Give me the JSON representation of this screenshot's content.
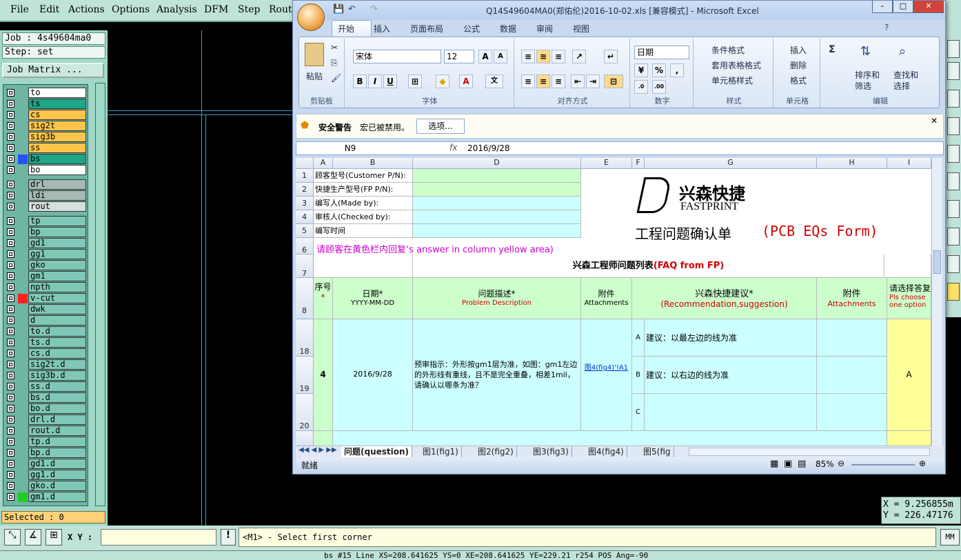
{
  "cam": {
    "menu": [
      "File",
      "Edit",
      "Actions",
      "Options",
      "Analysis",
      "DFM",
      "Step",
      "Rout"
    ],
    "job_label": "Job : 4s49604ma0",
    "step_label": "Step: set",
    "job_matrix_label": "Job Matrix ...",
    "selected_label": "Selected : 0",
    "xy_label": "X Y :",
    "message": "<M1> - Select first corner",
    "mm_label": "MM",
    "footer_text": "bs #15 Line XS=208.641625 YS=0 XE=208.641625 YE=229.21 r254 POS Ang=-90",
    "coord_x": "X = 9.256855m",
    "coord_y": "Y = 226.47176"
  },
  "layers": [
    {
      "name": "to",
      "color": "#ffffff",
      "dot": ""
    },
    {
      "name": "ts",
      "color": "#1fa587",
      "dot": ""
    },
    {
      "name": "cs",
      "color": "#ffc54a",
      "dot": ""
    },
    {
      "name": "sig2t",
      "color": "#ffc54a",
      "dot": ""
    },
    {
      "name": "sig3b",
      "color": "#ffc54a",
      "dot": ""
    },
    {
      "name": "ss",
      "color": "#ffc54a",
      "dot": ""
    },
    {
      "name": "bs",
      "color": "#1fa587",
      "dot": "#2255ff"
    },
    {
      "name": "bo",
      "color": "#ffffff",
      "dot": ""
    },
    {
      "name": "drl",
      "color": "#a7b9b5",
      "dot": ""
    },
    {
      "name": "ldi",
      "color": "#a7b9b5",
      "dot": ""
    },
    {
      "name": "rout",
      "color": "#d7dfdd",
      "dot": ""
    },
    {
      "name": "tp",
      "color": "#7fc8b7",
      "dot": ""
    },
    {
      "name": "bp",
      "color": "#7fc8b7",
      "dot": ""
    },
    {
      "name": "gd1",
      "color": "#7fc8b7",
      "dot": ""
    },
    {
      "name": "gg1",
      "color": "#7fc8b7",
      "dot": ""
    },
    {
      "name": "gko",
      "color": "#7fc8b7",
      "dot": ""
    },
    {
      "name": "gm1",
      "color": "#7fc8b7",
      "dot": ""
    },
    {
      "name": "npth",
      "color": "#7fc8b7",
      "dot": ""
    },
    {
      "name": "v-cut",
      "color": "#7fc8b7",
      "dot": "#ff2020"
    },
    {
      "name": "dwk",
      "color": "#7fc8b7",
      "dot": ""
    },
    {
      "name": "d",
      "color": "#7fc8b7",
      "dot": ""
    },
    {
      "name": "to.d",
      "color": "#7fc8b7",
      "dot": ""
    },
    {
      "name": "ts.d",
      "color": "#7fc8b7",
      "dot": ""
    },
    {
      "name": "cs.d",
      "color": "#7fc8b7",
      "dot": ""
    },
    {
      "name": "sig2t.d",
      "color": "#7fc8b7",
      "dot": ""
    },
    {
      "name": "sig3b.d",
      "color": "#7fc8b7",
      "dot": ""
    },
    {
      "name": "ss.d",
      "color": "#7fc8b7",
      "dot": ""
    },
    {
      "name": "bs.d",
      "color": "#7fc8b7",
      "dot": ""
    },
    {
      "name": "bo.d",
      "color": "#7fc8b7",
      "dot": ""
    },
    {
      "name": "drl.d",
      "color": "#7fc8b7",
      "dot": ""
    },
    {
      "name": "rout.d",
      "color": "#7fc8b7",
      "dot": ""
    },
    {
      "name": "tp.d",
      "color": "#7fc8b7",
      "dot": ""
    },
    {
      "name": "bp.d",
      "color": "#7fc8b7",
      "dot": ""
    },
    {
      "name": "gd1.d",
      "color": "#7fc8b7",
      "dot": ""
    },
    {
      "name": "gg1.d",
      "color": "#7fc8b7",
      "dot": ""
    },
    {
      "name": "gko.d",
      "color": "#7fc8b7",
      "dot": ""
    },
    {
      "name": "gm1.d",
      "color": "#7fc8b7",
      "dot": "#22cc22"
    }
  ],
  "excel": {
    "title": "Q14S49604MA0(郑佑伦)2016-10-02.xls  [兼容模式] - Microsoft Excel",
    "tabs": [
      "开始",
      "插入",
      "页面布局",
      "公式",
      "数据",
      "审阅",
      "视图"
    ],
    "groups": {
      "clipboard": "剪贴板",
      "font": "字体",
      "align": "对齐方式",
      "number": "数字",
      "styles": "样式",
      "cells": "单元格",
      "edit": "编辑"
    },
    "paste": "粘贴",
    "font_name": "宋体",
    "font_size": "12",
    "number_format": "日期",
    "styles_items": [
      "条件格式",
      "套用表格格式",
      "单元格样式"
    ],
    "cells_items": [
      "插入",
      "删除",
      "格式"
    ],
    "edit_items": [
      "排序和",
      "筛选",
      "查找和",
      "选择"
    ],
    "security_title": "安全警告",
    "security_msg": "宏已被禁用。",
    "options_btn": "选项...",
    "name_box": "N9",
    "fx": "fx",
    "formula": "2016/9/28",
    "cols": [
      "A",
      "B",
      "D",
      "E",
      "F",
      "G",
      "H",
      "I"
    ],
    "rows": [
      "1",
      "2",
      "3",
      "4",
      "5",
      "6",
      "7",
      "8",
      "18",
      "19",
      "20"
    ],
    "b1": "顾客型号(Customer P/N):",
    "b2": "快捷生产型号(FP P/N):",
    "b3": "编写人(Made by):",
    "b4": "审核人(Checked by):",
    "b5": "编写时间",
    "row6": "请顾客在黄色栏内回复‘s answer in column yellow area)",
    "logo_cn": "兴森快捷",
    "logo_en": "FASTPRINT",
    "form_title": "工程问题确认单",
    "form_title_en": "(PCB EQs Form)",
    "faq": "兴森工程师问题列表",
    "faq_en": "(FAQ from FP)",
    "h_seq": "序号",
    "h_date": "日期*",
    "h_date2": "YYYY-MM-DD",
    "h_desc": "问题描述*",
    "h_desc2": "Problem Description",
    "h_att": "附件",
    "h_att2": "Attachments",
    "h_rec": "兴森快捷建议*",
    "h_rec2": "(Recommendation,suggestion)",
    "h_att3": "附件",
    "h_att4": "Attachments",
    "h_ans": "请选择答复",
    "h_ans2": "Pls choose",
    "h_ans3": "one option",
    "r_seq": "4",
    "r_date": "2016/9/28",
    "r_desc": "预审指示：外形按gm1层为准，如图：gm1左边的外形线有重线，且不是完全重叠，相差1mil，请确认以哪条为准？",
    "r_link": "图4(fig4)'!A1",
    "optA": "A",
    "optB": "B",
    "optC": "C",
    "recA": "建议：以最左边的线为准",
    "recB": "建议：以右边的线为准",
    "answer": "A",
    "sheets": [
      "问题(question)",
      "图1(fig1)",
      "图2(fig2)",
      "图3(fig3)",
      "图4(fig4)",
      "图5(fig"
    ],
    "status": "就绪",
    "zoom": "85%"
  }
}
